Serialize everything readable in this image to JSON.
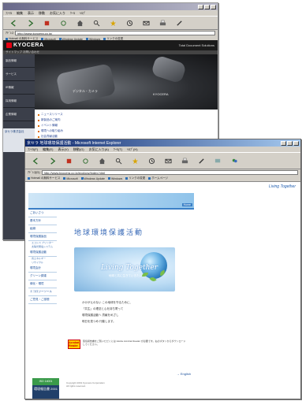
{
  "window_back": {
    "title": "",
    "menu": [
      "ﾌｧｲﾙ",
      "編集",
      "表示",
      "移動",
      "お気に入り",
      "ﾂｰﾙ",
      "ﾍﾙﾌﾟ"
    ],
    "address_label": "ｱﾄﾞﾚｽ",
    "address": "http://www.kyocera.co.jp/",
    "links": [
      "Hotmail の無料サービス",
      "Microsoft",
      "Windows Update",
      "Windows",
      "リンクの変更"
    ],
    "brand": "KYOCERA",
    "header_tag": "Total Document Solutions",
    "subnav": "サイトマップ  お問い合わせ",
    "left_nav": [
      "製品情報",
      "サービス",
      "IR情報",
      "採用情報",
      "企業情報"
    ],
    "hero_caption": "デジタル・カメラ",
    "hero_model": "KYOCERA",
    "news": [
      "ニュースリリース",
      "新製品のご案内",
      "イベント情報",
      "環境への取り組み",
      "社会貢献活動",
      "サポート"
    ],
    "side_info": "京セラ株式会社"
  },
  "window_front": {
    "title": "京セラ 地球環境保護活動 - Microsoft Internet Explorer",
    "menu": [
      "ﾌｧｲﾙ(F)",
      "編集(E)",
      "表示(V)",
      "移動(G)",
      "お気に入り(A)",
      "ﾂｰﾙ(T)",
      "ﾍﾙﾌﾟ(H)"
    ],
    "address_label": "ｱﾄﾞﾚｽ(D)",
    "address": "http://www.kyocera.co.jp/ecology/index.html",
    "links": [
      "Hotmail の無料サービス",
      "Microsoft",
      "Windows Update",
      "Windows",
      "リンクの変更",
      "ホームページ"
    ],
    "top_tagline": "Living Together",
    "banner_nav": "Home",
    "left_nav": [
      {
        "label": "ごあいさつ",
        "subs": []
      },
      {
        "label": "基本方針",
        "subs": []
      },
      {
        "label": "組織",
        "subs": []
      },
      {
        "label": "環境保護製品",
        "subs": [
          "エコシス プリンター",
          "太陽光発電システム"
        ]
      },
      {
        "label": "環境保護活動",
        "subs": [
          "省エネルギー",
          "リサイクル"
        ]
      },
      {
        "label": "環境会計",
        "subs": []
      },
      {
        "label": "グリーン調達",
        "subs": []
      },
      {
        "label": "緑化・環境",
        "subs": []
      },
      {
        "label": "エコロジーツール",
        "subs": []
      },
      {
        "label": "ご意見・ご感想",
        "subs": []
      }
    ],
    "main_title": "地球環境保護活動",
    "visual_script": "Living Together",
    "visual_small": "地球と共に生きていきたい",
    "poem": [
      "かけがえのない この地球を守るために、",
      "「共生」の理念と心を持ち寄って",
      "環境保護活動へ 貢献をめざし",
      "明日を見つめ 行動します。"
    ],
    "reader_badge": "Acrobat Reader",
    "reader_text": "環境報告書をご覧いただくには Adobe Acrobat Reader が必要です。右のボタンからダウンロードしてください。",
    "to_english": "→ English",
    "copyright": [
      "Copyright 2001 Kyocera Corporation",
      "All rights reserved."
    ],
    "stamp_top": "ISO 14001",
    "stamp_bottom": "環境報告書 2001"
  }
}
